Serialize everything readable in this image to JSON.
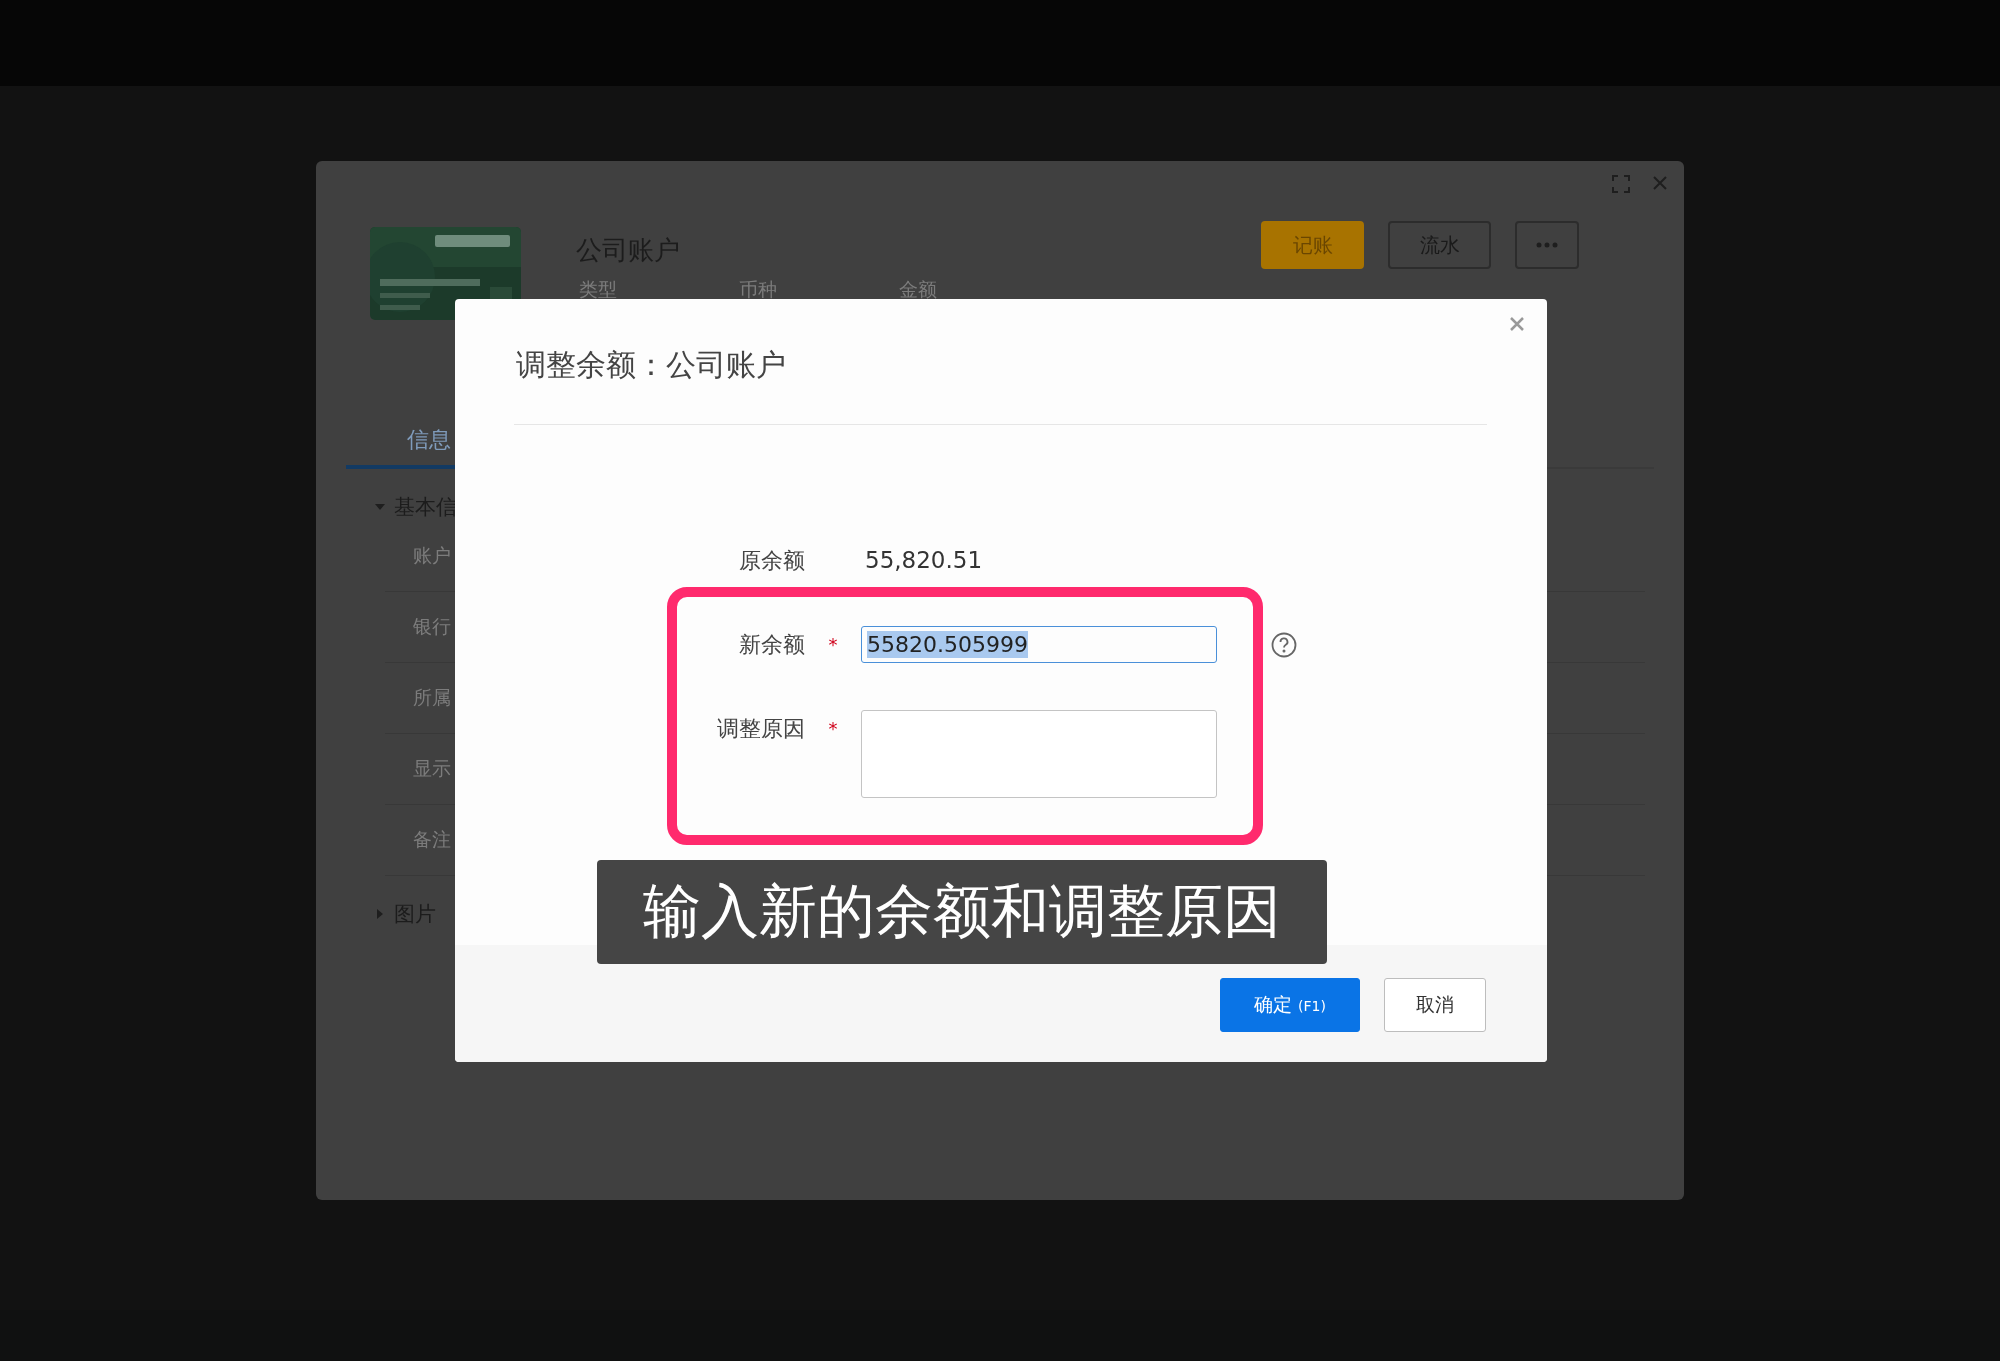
{
  "background_window": {
    "account_name": "公司账户",
    "actions": [
      {
        "kind": "primary",
        "label": "记账"
      },
      {
        "kind": "default",
        "label": "流水"
      },
      {
        "kind": "more"
      }
    ],
    "summary_labels": [
      "类型",
      "币种",
      "金额"
    ],
    "tabs": [
      {
        "label": "信息",
        "selected": true
      }
    ],
    "sections": [
      {
        "title": "基本信",
        "expanded": true,
        "fields": [
          "账户",
          "银行",
          "所属",
          "显示",
          "备注"
        ]
      },
      {
        "title": "图片",
        "expanded": false
      }
    ]
  },
  "dialog": {
    "title": "调整余额：公司账户",
    "fields": [
      {
        "kind": "text",
        "label": "原余额",
        "value": "55,820.51"
      },
      {
        "kind": "input",
        "label": "新余额",
        "required_mark": "*",
        "value": "55820.505999",
        "text_selected": true,
        "help": true
      },
      {
        "kind": "textarea",
        "label": "调整原因",
        "required_mark": "*"
      }
    ],
    "buttons": [
      {
        "kind": "primary",
        "label": "确定",
        "shortcut": "(F1)"
      },
      {
        "kind": "default",
        "label": "取消"
      }
    ]
  },
  "caption": "输入新的余额和调整原因"
}
